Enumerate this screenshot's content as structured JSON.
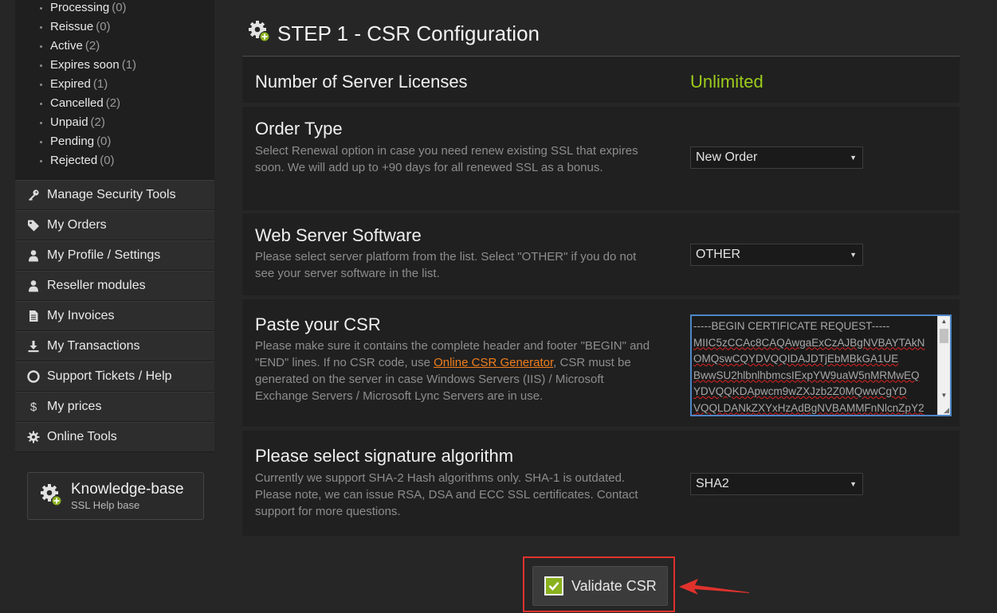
{
  "sidebar": {
    "status_items": [
      {
        "label": "Processing",
        "count": "(0)"
      },
      {
        "label": "Reissue",
        "count": "(0)"
      },
      {
        "label": "Active",
        "count": "(2)"
      },
      {
        "label": "Expires soon",
        "count": "(1)"
      },
      {
        "label": "Expired",
        "count": "(1)"
      },
      {
        "label": "Cancelled",
        "count": "(2)"
      },
      {
        "label": "Unpaid",
        "count": "(2)"
      },
      {
        "label": "Pending",
        "count": "(0)"
      },
      {
        "label": "Rejected",
        "count": "(0)"
      }
    ],
    "menu": [
      {
        "label": "Manage Security Tools",
        "icon": "key-icon"
      },
      {
        "label": "My Orders",
        "icon": "tag-icon"
      },
      {
        "label": "My Profile / Settings",
        "icon": "user-icon"
      },
      {
        "label": "Reseller modules",
        "icon": "user-icon"
      },
      {
        "label": "My Invoices",
        "icon": "document-icon"
      },
      {
        "label": "My Transactions",
        "icon": "download-icon"
      },
      {
        "label": "Support Tickets / Help",
        "icon": "lifebuoy-icon"
      },
      {
        "label": "My prices",
        "icon": "dollar-icon"
      },
      {
        "label": "Online Tools",
        "icon": "gear-icon"
      }
    ],
    "knowledge_base": {
      "title": "Knowledge-base",
      "subtitle": "SSL Help base"
    }
  },
  "main": {
    "step_title": "STEP 1 - CSR Configuration",
    "licenses": {
      "label": "Number of Server Licenses",
      "value": "Unlimited"
    },
    "order_type": {
      "label": "Order Type",
      "description": "Select Renewal option in case you need renew existing SSL that expires soon. We will add up to +90 days for all renewed SSL as a bonus.",
      "selected": "New Order"
    },
    "web_server": {
      "label": "Web Server Software",
      "description": "Please select server platform from the list. Select \"OTHER\" if you do not see your server software in the list.",
      "selected": "OTHER"
    },
    "csr": {
      "label": "Paste your CSR",
      "description_before": "Please make sure it contains the complete header and footer \"BEGIN\" and \"END\" lines. If no CSR code, use ",
      "link_text": "Online CSR Generator",
      "description_after": ", CSR must be generated on the server in case Windows Servers (IIS) / Microsoft Exchange Servers / Microsoft Lync Servers are in use.",
      "lines": [
        "-----BEGIN CERTIFICATE REQUEST-----",
        "MIIC5zCCAc8CAQAwgaExCzAJBgNVBAYTAkN",
        "OMQswCQYDVQQIDAJDTjEbMBkGA1UE",
        "BwwSU2hlbnlhbmcsIExpYW9uaW5nMRMwEQ",
        "YDVQQKDApwcm9wZXJzb2Z0MQwwCgYD",
        "VQQLDANkZXYxHzAdBgNVBAMMFnNlcnZpY2"
      ]
    },
    "signature": {
      "label": "Please select signature algorithm",
      "description": "Currently we support SHA-2 Hash algorithms only. SHA-1 is outdated. Please note, we can issue RSA, DSA and ECC SSL certificates. Contact support for more questions.",
      "selected": "SHA2"
    },
    "validate_button": "Validate CSR"
  },
  "colors": {
    "accent_green": "#9ccc1c",
    "link_orange": "#f07e1d",
    "highlight_red": "#e0322d",
    "focus_blue": "#4f86c6"
  }
}
